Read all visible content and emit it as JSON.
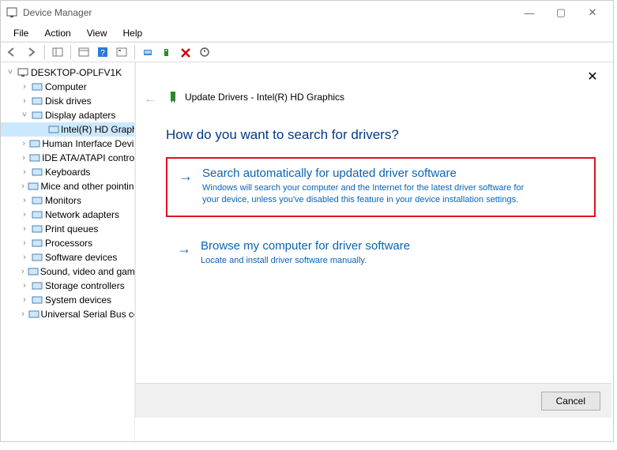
{
  "window": {
    "title": "Device Manager"
  },
  "menubar": {
    "file": "File",
    "action": "Action",
    "view": "View",
    "help": "Help"
  },
  "tree": {
    "root": "DESKTOP-OPLFV1K",
    "items": [
      {
        "label": "Computer"
      },
      {
        "label": "Disk drives"
      },
      {
        "label": "Display adapters",
        "expanded": true,
        "child": "Intel(R) HD Graphics"
      },
      {
        "label": "Human Interface Devices"
      },
      {
        "label": "IDE ATA/ATAPI controllers"
      },
      {
        "label": "Keyboards"
      },
      {
        "label": "Mice and other pointing devices"
      },
      {
        "label": "Monitors"
      },
      {
        "label": "Network adapters"
      },
      {
        "label": "Print queues"
      },
      {
        "label": "Processors"
      },
      {
        "label": "Software devices"
      },
      {
        "label": "Sound, video and game controllers"
      },
      {
        "label": "Storage controllers"
      },
      {
        "label": "System devices"
      },
      {
        "label": "Universal Serial Bus controllers"
      }
    ]
  },
  "dialog": {
    "title": "Update Drivers - Intel(R) HD Graphics",
    "question": "How do you want to search for drivers?",
    "option1_title": "Search automatically for updated driver software",
    "option1_desc": "Windows will search your computer and the Internet for the latest driver software for your device, unless you've disabled this feature in your device installation settings.",
    "option2_title": "Browse my computer for driver software",
    "option2_desc": "Locate and install driver software manually.",
    "cancel": "Cancel"
  }
}
